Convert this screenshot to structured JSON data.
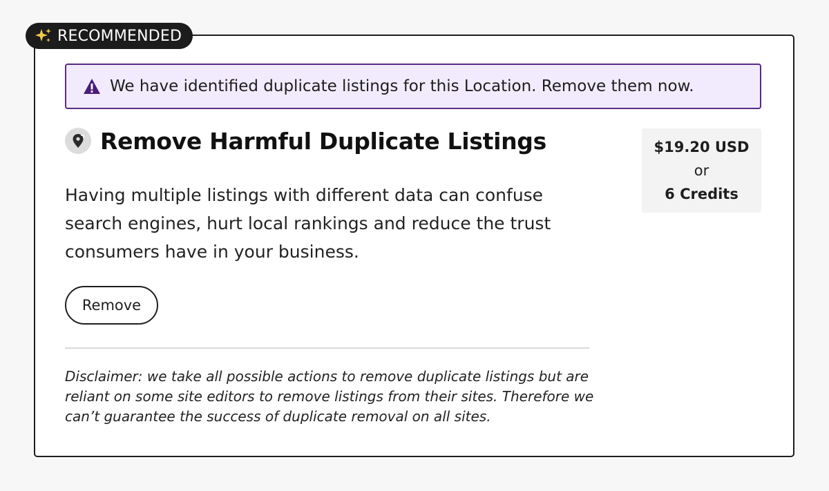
{
  "badge": {
    "label": "RECOMMENDED",
    "icon": "sparkles-icon",
    "icon_color": "#f2c94c",
    "background": "#1c1c1c"
  },
  "alert": {
    "message": "We have identified duplicate listings for this Location. Remove them now.",
    "icon": "warning-triangle-icon",
    "accent_color": "#5a2a86",
    "background": "#f1ebfd"
  },
  "service": {
    "icon": "location-pin-icon",
    "title": "Remove Harmful Duplicate Listings",
    "description": "Having multiple listings with different data can confuse search engines, hurt local rankings and reduce the trust consumers have in your business.",
    "action_label": "Remove",
    "disclaimer": "Disclaimer: we take all possible actions to remove duplicate listings but are reliant on some site editors to remove listings from their sites. Therefore we can’t guarantee the success of duplicate removal on all sites."
  },
  "pricing": {
    "price": "$19.20 USD",
    "separator": "or",
    "credits": "6 Credits"
  }
}
